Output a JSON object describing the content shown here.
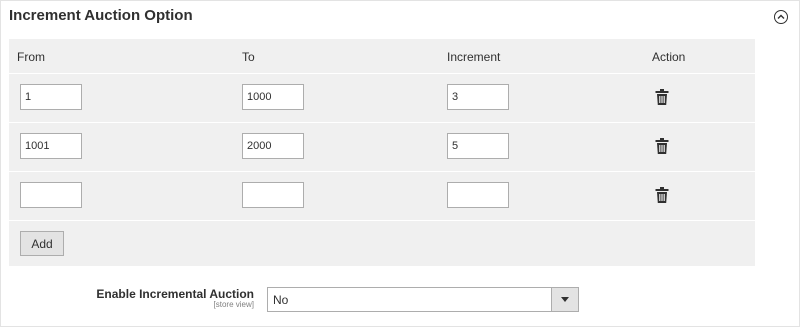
{
  "section": {
    "title": "Increment Auction Option",
    "collapse_icon": "chevron-up-circle-icon"
  },
  "table": {
    "headers": {
      "from": "From",
      "to": "To",
      "increment": "Increment",
      "action": "Action"
    },
    "rows": [
      {
        "from": "1",
        "to": "1000",
        "increment": "3"
      },
      {
        "from": "1001",
        "to": "2000",
        "increment": "5"
      },
      {
        "from": "",
        "to": "",
        "increment": ""
      }
    ],
    "delete_icon": "trash-icon",
    "add_label": "Add"
  },
  "enable_field": {
    "label": "Enable Incremental Auction",
    "scope": "[store view]",
    "value": "No",
    "dropdown_icon": "caret-down-icon"
  },
  "colors": {
    "grid_background": "#f0f0f0",
    "text": "#303030",
    "border": "#adadad",
    "button_background": "#e3e3e3"
  }
}
